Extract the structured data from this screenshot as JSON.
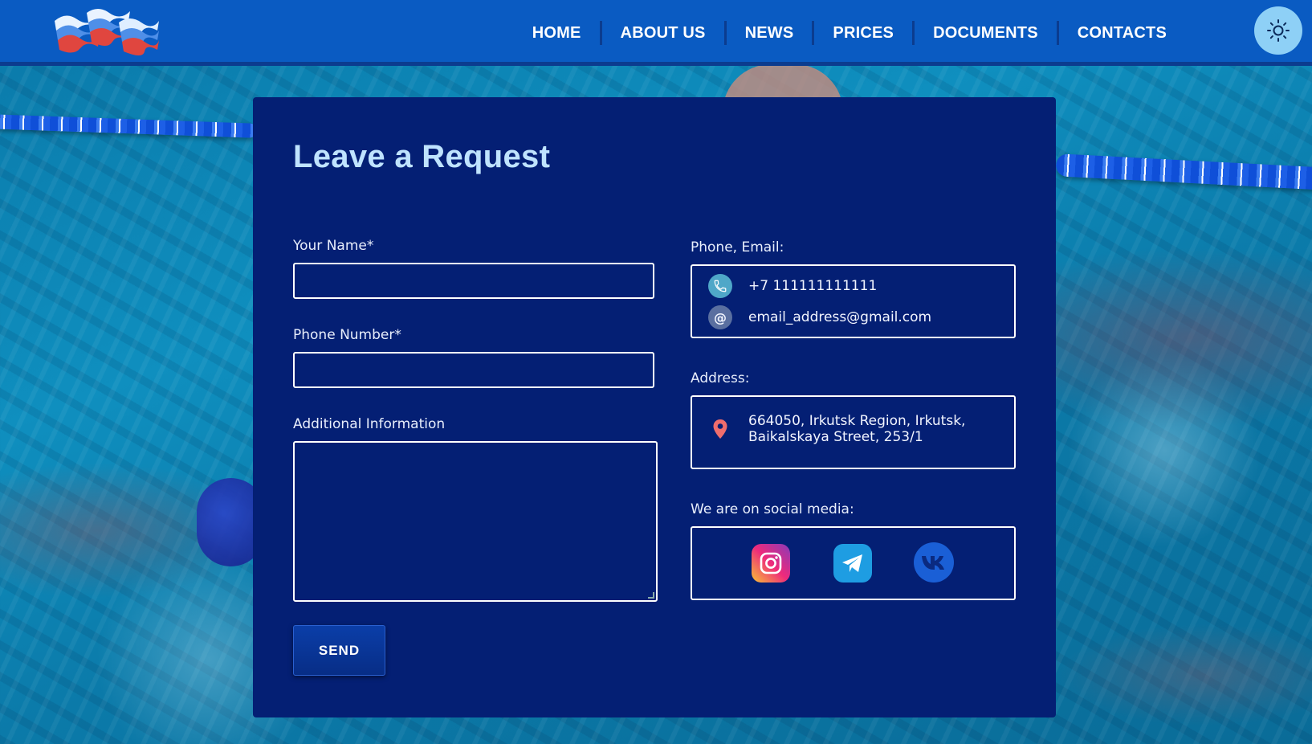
{
  "header": {
    "nav": [
      {
        "label": "HOME"
      },
      {
        "label": "ABOUT US"
      },
      {
        "label": "NEWS"
      },
      {
        "label": "PRICES"
      },
      {
        "label": "DOCUMENTS"
      },
      {
        "label": "CONTACTS"
      }
    ],
    "theme_icon": "sun-icon"
  },
  "form": {
    "title": "Leave a Request",
    "name_label": "Your Name*",
    "name_value": "",
    "phone_label": "Phone Number*",
    "phone_value": "",
    "info_label": "Additional Information",
    "info_value": "",
    "send_label": "SEND"
  },
  "contacts": {
    "phone_email_label": "Phone, Email:",
    "phone": "+7 111111111111",
    "email": "email_address@gmail.com",
    "address_label": "Address:",
    "address_line1": "664050, Irkutsk Region, Irkutsk,",
    "address_line2": "Baikalskaya Street, 253/1",
    "social_label": "We are on social media:",
    "social": [
      {
        "name": "instagram-icon"
      },
      {
        "name": "telegram-icon"
      },
      {
        "name": "vk-icon"
      }
    ]
  },
  "colors": {
    "header": "#0a5bc2",
    "card": "#041f74",
    "title": "#bfe3ff",
    "theme_button": "#8ed0f6"
  }
}
